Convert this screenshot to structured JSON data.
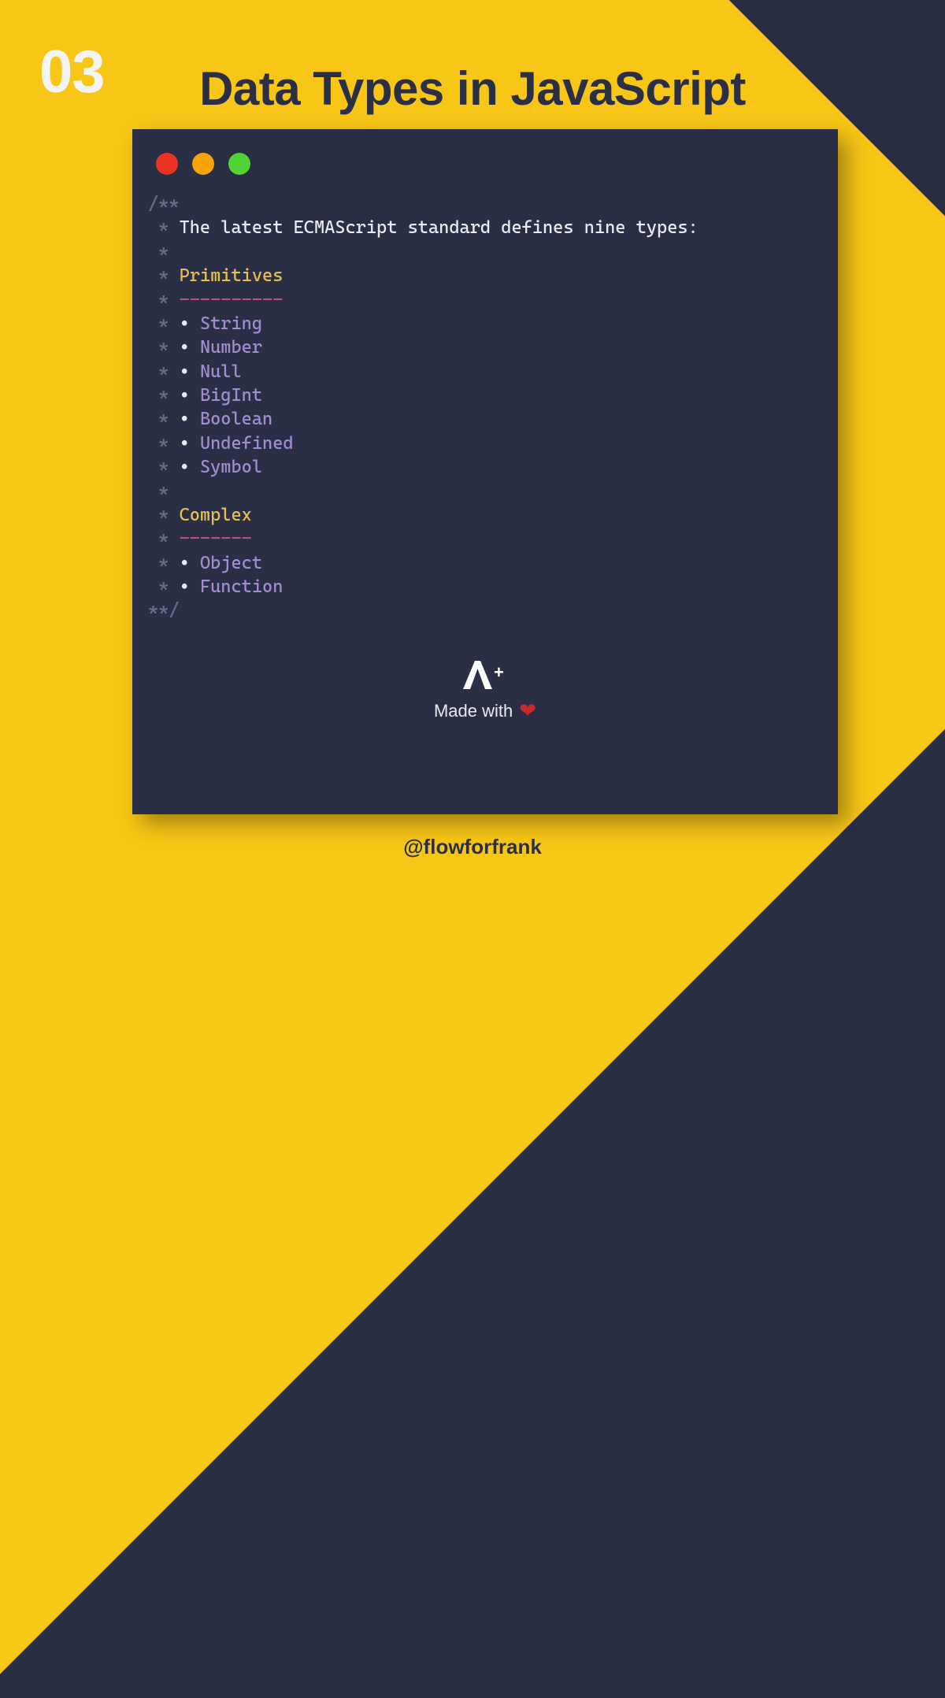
{
  "page_number": "03",
  "title": "Data Types in JavaScript",
  "code": {
    "open": "/**",
    "intro": "The latest ECMAScript standard defines nine types:",
    "section_primitives": {
      "label": "Primitives",
      "underline": "----------",
      "items": [
        "String",
        "Number",
        "Null",
        "BigInt",
        "Boolean",
        "Undefined",
        "Symbol"
      ]
    },
    "section_complex": {
      "label": "Complex",
      "underline": "-------",
      "items": [
        "Object",
        "Function"
      ]
    },
    "close": "**/"
  },
  "footer": {
    "logo_text": "A+",
    "made_with": "Made with",
    "heart": "❤",
    "handle": "@flowforfrank"
  },
  "colors": {
    "bg_dark": "#2B2F45",
    "accent_yellow": "#F8C616",
    "comment_dim": "#6A6D87",
    "text_white": "#E9EBF0",
    "heading_gold": "#E5BF52",
    "divider_pink": "#BF4B8A",
    "type_purple": "#A08CCF",
    "heart_red": "#C62A29"
  }
}
